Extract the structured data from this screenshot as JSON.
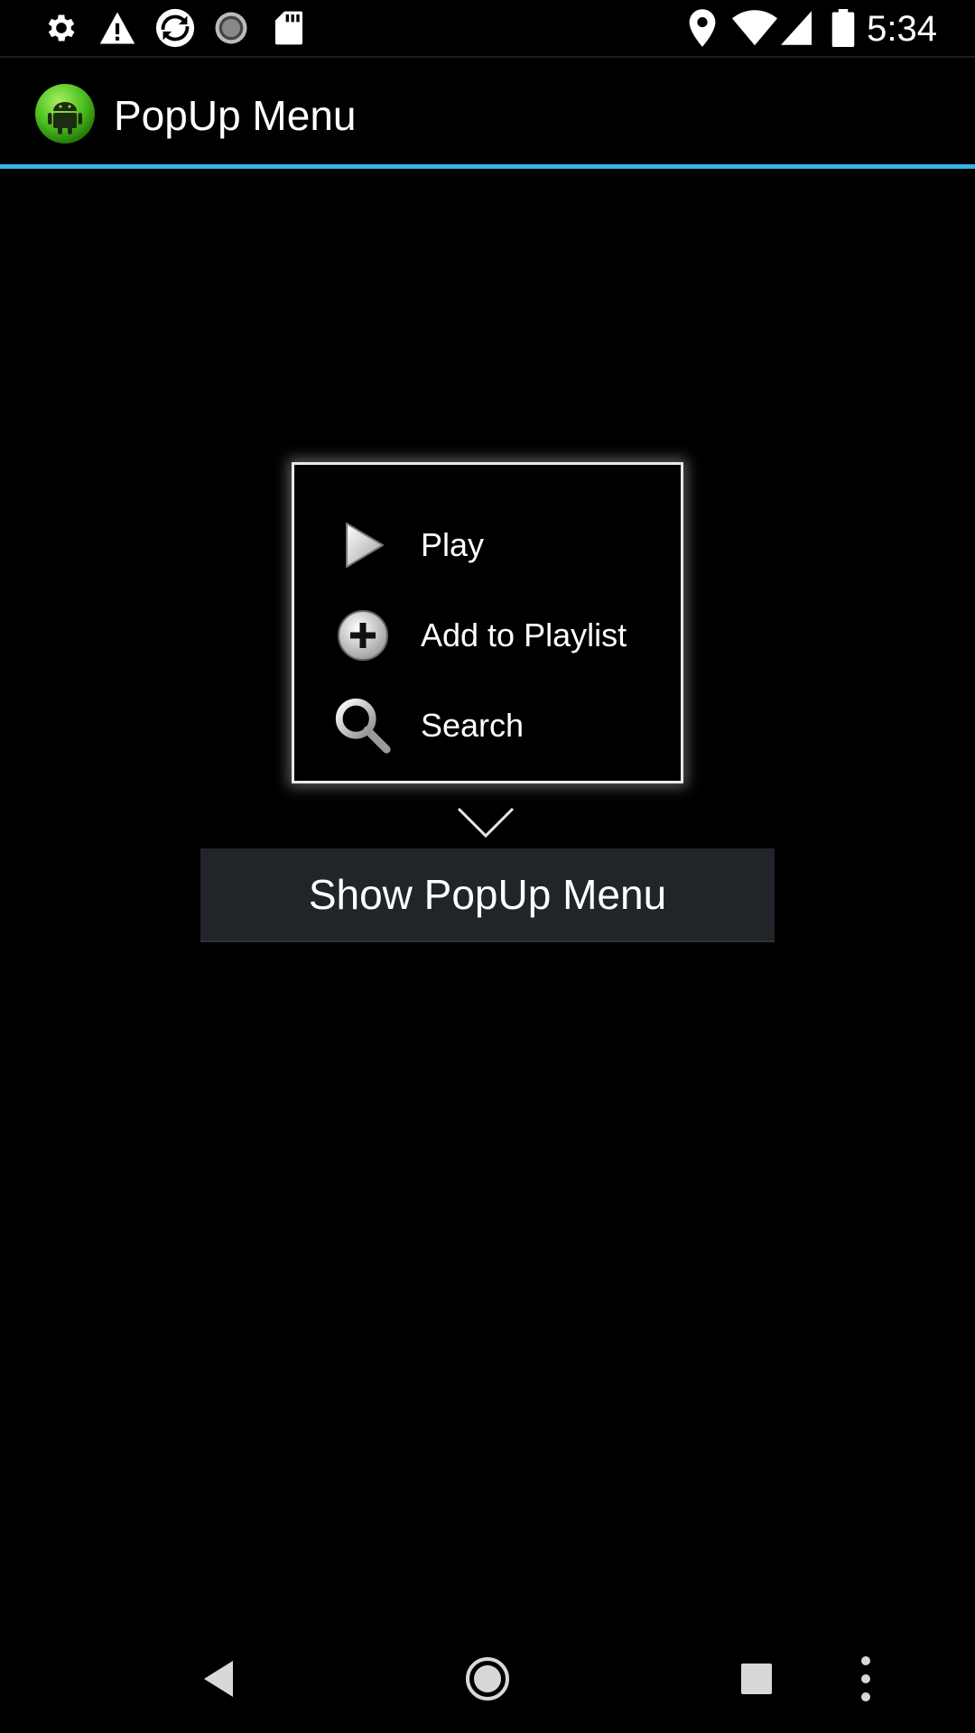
{
  "status_bar": {
    "left_icons": [
      "settings-icon",
      "warning-icon",
      "sync-app-icon",
      "loading-icon",
      "sd-card-icon"
    ],
    "right_icons": [
      "location-icon",
      "wifi-icon",
      "signal-icon",
      "battery-icon"
    ],
    "time": "5:34"
  },
  "action_bar": {
    "logo": "android-logo-icon",
    "title": "PopUp Menu",
    "accent_color": "#33b5e5"
  },
  "popup_menu": {
    "items": [
      {
        "label": "Play",
        "icon": "play-icon"
      },
      {
        "label": "Add to Playlist",
        "icon": "add-circle-icon"
      },
      {
        "label": "Search",
        "icon": "search-icon"
      }
    ]
  },
  "main": {
    "button_label": "Show PopUp Menu"
  },
  "nav_bar": {
    "buttons": [
      "back-icon",
      "home-icon",
      "recents-icon",
      "overflow-menu-icon"
    ]
  }
}
